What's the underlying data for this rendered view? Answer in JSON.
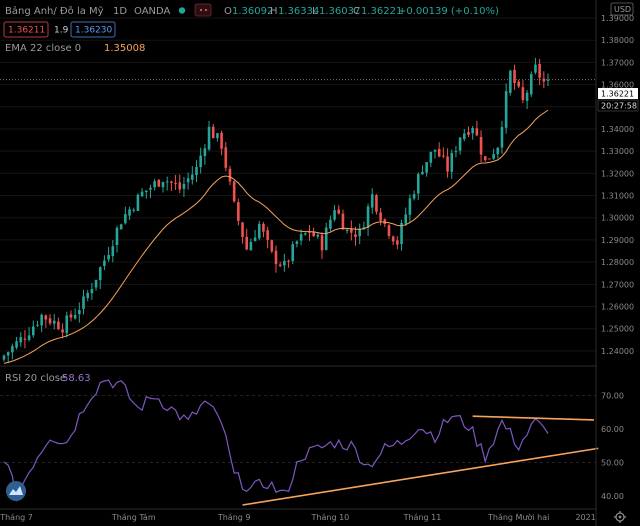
{
  "header": {
    "symbol": "Bảng Anh/ Đô la Mỹ",
    "interval": "1D",
    "source": "OANDA",
    "ohlc": {
      "open_label": "O",
      "open": "1.36092",
      "high_label": "H",
      "high": "1.36334",
      "low_label": "L",
      "low": "1.36037",
      "close_label": "C",
      "close": "1.36221",
      "change": "+0.00139 (+0.10%)"
    },
    "bid": "1.36211",
    "spread": "1.9",
    "ask": "1.36230",
    "currency_button": "USD"
  },
  "ema_legend": {
    "label": "EMA 22 close 0",
    "value": "1.35008"
  },
  "rsi_legend": {
    "label": "RSI 20 close",
    "value": "58.63"
  },
  "price_badge": {
    "price": "1.36221",
    "countdown": "20:27:58"
  },
  "colors": {
    "up": "#26a69a",
    "down": "#ef5350",
    "ema": "#f7a35c",
    "rsi": "#7e57c2",
    "trendline": "#f7a35c",
    "background": "#000000"
  },
  "chart_data": [
    {
      "type": "candlestick",
      "title": "Bảng Anh/ Đô la Mỹ · 1D · OANDA",
      "indicator": "EMA 22 close 0",
      "ylim": [
        1.235,
        1.39
      ],
      "y_ticks": [
        "1.39000",
        "1.38000",
        "1.37000",
        "1.36000",
        "1.35000",
        "1.34000",
        "1.33000",
        "1.32000",
        "1.31000",
        "1.30000",
        "1.29000",
        "1.28000",
        "1.27000",
        "1.26000",
        "1.25000",
        "1.24000"
      ],
      "x_ticks": [
        "Tháng 7",
        "Tháng Tám",
        "Tháng 9",
        "Tháng 10",
        "Tháng 11",
        "Tháng Mười hai",
        "2021"
      ],
      "anchors": [
        {
          "i": 0,
          "c": 1.238
        },
        {
          "i": 5,
          "c": 1.247
        },
        {
          "i": 9,
          "c": 1.256
        },
        {
          "i": 14,
          "c": 1.251
        },
        {
          "i": 19,
          "c": 1.262
        },
        {
          "i": 24,
          "c": 1.281
        },
        {
          "i": 28,
          "c": 1.299
        },
        {
          "i": 33,
          "c": 1.311
        },
        {
          "i": 38,
          "c": 1.318
        },
        {
          "i": 42,
          "c": 1.313
        },
        {
          "i": 46,
          "c": 1.322
        },
        {
          "i": 49,
          "c": 1.34
        },
        {
          "i": 52,
          "c": 1.333
        },
        {
          "i": 55,
          "c": 1.305
        },
        {
          "i": 58,
          "c": 1.286
        },
        {
          "i": 61,
          "c": 1.297
        },
        {
          "i": 64,
          "c": 1.283
        },
        {
          "i": 67,
          "c": 1.278
        },
        {
          "i": 70,
          "c": 1.289
        },
        {
          "i": 73,
          "c": 1.294
        },
        {
          "i": 76,
          "c": 1.288
        },
        {
          "i": 79,
          "c": 1.305
        },
        {
          "i": 82,
          "c": 1.294
        },
        {
          "i": 85,
          "c": 1.293
        },
        {
          "i": 88,
          "c": 1.31
        },
        {
          "i": 91,
          "c": 1.297
        },
        {
          "i": 94,
          "c": 1.289
        },
        {
          "i": 97,
          "c": 1.308
        },
        {
          "i": 100,
          "c": 1.323
        },
        {
          "i": 103,
          "c": 1.331
        },
        {
          "i": 106,
          "c": 1.322
        },
        {
          "i": 109,
          "c": 1.337
        },
        {
          "i": 112,
          "c": 1.342
        },
        {
          "i": 115,
          "c": 1.325
        },
        {
          "i": 118,
          "c": 1.333
        },
        {
          "i": 121,
          "c": 1.365
        },
        {
          "i": 124,
          "c": 1.352
        },
        {
          "i": 127,
          "c": 1.367
        },
        {
          "i": 129,
          "c": 1.361
        },
        {
          "i": 130,
          "c": 1.3622
        }
      ],
      "ema_end": 1.35008,
      "last_close": 1.36221
    },
    {
      "type": "line",
      "title": "RSI 20 close",
      "ylim": [
        37,
        77
      ],
      "y_ticks": [
        "70.00",
        "60.00",
        "50.00",
        "40.00"
      ],
      "x_ticks": [
        "Tháng 7",
        "Tháng Tám",
        "Tháng 9",
        "Tháng 10",
        "Tháng 11",
        "Tháng Mười hai",
        "2021"
      ],
      "anchors": [
        {
          "i": 0,
          "v": 52
        },
        {
          "i": 3,
          "v": 40
        },
        {
          "i": 7,
          "v": 50
        },
        {
          "i": 11,
          "v": 58
        },
        {
          "i": 15,
          "v": 56
        },
        {
          "i": 20,
          "v": 69
        },
        {
          "i": 24,
          "v": 75
        },
        {
          "i": 28,
          "v": 73
        },
        {
          "i": 32,
          "v": 66
        },
        {
          "i": 36,
          "v": 70
        },
        {
          "i": 40,
          "v": 66
        },
        {
          "i": 44,
          "v": 62
        },
        {
          "i": 48,
          "v": 68
        },
        {
          "i": 52,
          "v": 62
        },
        {
          "i": 55,
          "v": 46
        },
        {
          "i": 59,
          "v": 42
        },
        {
          "i": 63,
          "v": 44
        },
        {
          "i": 67,
          "v": 40
        },
        {
          "i": 71,
          "v": 52
        },
        {
          "i": 75,
          "v": 54
        },
        {
          "i": 79,
          "v": 56
        },
        {
          "i": 83,
          "v": 55
        },
        {
          "i": 87,
          "v": 49
        },
        {
          "i": 91,
          "v": 54
        },
        {
          "i": 95,
          "v": 56
        },
        {
          "i": 99,
          "v": 61
        },
        {
          "i": 103,
          "v": 58
        },
        {
          "i": 107,
          "v": 64
        },
        {
          "i": 111,
          "v": 61
        },
        {
          "i": 115,
          "v": 52
        },
        {
          "i": 119,
          "v": 62
        },
        {
          "i": 123,
          "v": 55
        },
        {
          "i": 127,
          "v": 62
        },
        {
          "i": 130,
          "v": 58.63
        }
      ],
      "reference_lines": [
        70,
        50
      ],
      "trendlines": [
        {
          "from": {
            "i": 57,
            "v": 37.3
          },
          "to": {
            "i": 142,
            "v": 54.2
          }
        },
        {
          "from": {
            "i": 112,
            "v": 63.8
          },
          "to": {
            "i": 141,
            "v": 62.7
          }
        }
      ]
    }
  ]
}
